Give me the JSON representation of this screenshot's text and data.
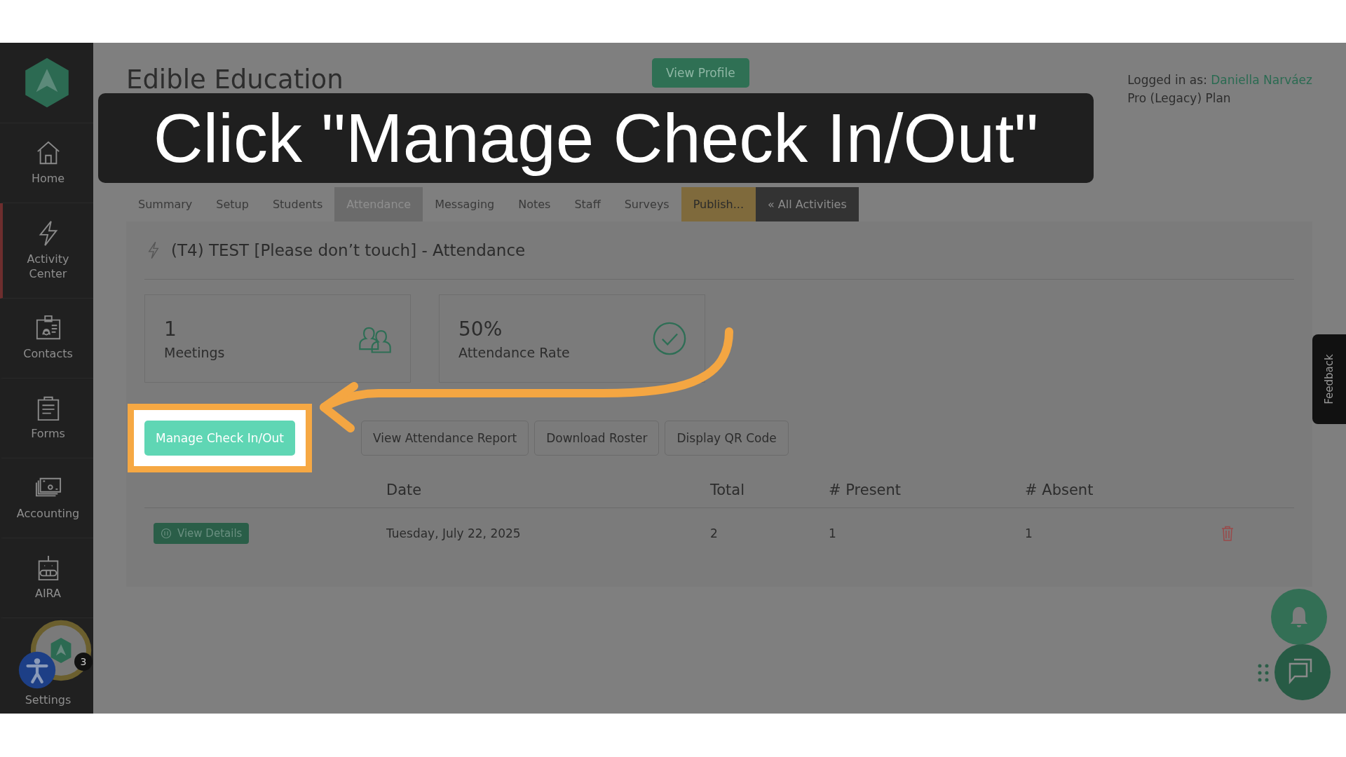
{
  "caption": {
    "text": "Click \"Manage Check In/Out\""
  },
  "sidebar": {
    "items": [
      {
        "label": "Home",
        "selected": false
      },
      {
        "label": "Activity Center",
        "selected": true
      },
      {
        "label": "Contacts",
        "selected": false
      },
      {
        "label": "Forms",
        "selected": false
      },
      {
        "label": "Accounting",
        "selected": false
      },
      {
        "label": "AIRA",
        "selected": false
      },
      {
        "label": "Settings",
        "selected": false
      }
    ]
  },
  "notification_badge": "3",
  "header": {
    "title": "Edible Education",
    "view_profile": "View Profile",
    "logged_in_label": "Logged in as:",
    "user_name": "Daniella Narváez",
    "plan": "Pro (Legacy) Plan"
  },
  "tabs": [
    {
      "label": "Summary",
      "kind": "normal",
      "selected": false
    },
    {
      "label": "Setup",
      "kind": "normal",
      "selected": false
    },
    {
      "label": "Students",
      "kind": "normal",
      "selected": false
    },
    {
      "label": "Attendance",
      "kind": "normal",
      "selected": true
    },
    {
      "label": "Messaging",
      "kind": "normal",
      "selected": false
    },
    {
      "label": "Notes",
      "kind": "normal",
      "selected": false
    },
    {
      "label": "Staff",
      "kind": "normal",
      "selected": false
    },
    {
      "label": "Surveys",
      "kind": "normal",
      "selected": false
    },
    {
      "label": "Publish...",
      "kind": "publish",
      "selected": false
    },
    {
      "label": "« All Activities",
      "kind": "back",
      "selected": false
    }
  ],
  "activity_title": "(T4) TEST [Please don’t touch] - Attendance",
  "stats": [
    {
      "value": "1",
      "label": "Meetings",
      "kind": "meetings"
    },
    {
      "value": "50%",
      "label": "Attendance Rate",
      "kind": "rate"
    }
  ],
  "actions": [
    {
      "label": "Manage Check In/Out",
      "kind": "primary",
      "highlighted": true
    },
    {
      "label": "View Attendance Report",
      "kind": "secondary",
      "highlighted": false
    },
    {
      "label": "Download Roster",
      "kind": "secondary",
      "highlighted": false
    },
    {
      "label": "Display QR Code",
      "kind": "secondary",
      "highlighted": false
    }
  ],
  "table": {
    "columns": [
      "Date",
      "Total",
      "# Present",
      "# Absent"
    ],
    "rows": [
      {
        "action": "View Details",
        "cells": [
          "Tuesday, July 22, 2025",
          "2",
          "1",
          "1"
        ]
      }
    ]
  },
  "feedback": "Feedback"
}
